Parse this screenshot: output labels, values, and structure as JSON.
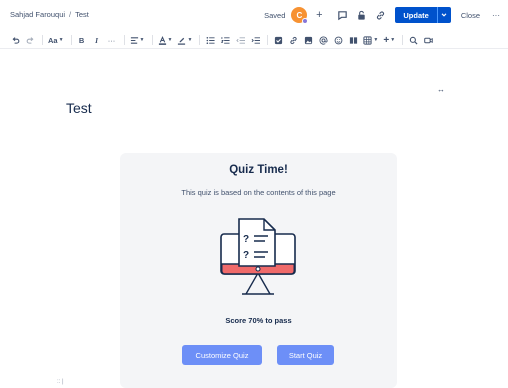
{
  "breadcrumb": {
    "space": "Sahjad Farouqui",
    "separator": "/",
    "page": "Test"
  },
  "header": {
    "saved_label": "Saved",
    "avatar_initial": "C",
    "add_label": "+",
    "update_label": "Update",
    "close_label": "Close",
    "more_label": "···"
  },
  "toolbar": {
    "text_style_label": "Aa",
    "bold_label": "B",
    "italic_label": "I",
    "more_formatting_label": "···",
    "insert_label": "+"
  },
  "page": {
    "title": "Test",
    "expand_label": "↔"
  },
  "quiz": {
    "title": "Quiz Time!",
    "description": "This quiz is based on the contents of this page",
    "score_text": "Score 70% to pass",
    "customize_label": "Customize Quiz",
    "start_label": "Start Quiz"
  },
  "footer": {
    "mark": ":: |"
  },
  "colors": {
    "primary": "#0052cc",
    "quiz_button": "#6d8ff7",
    "card_bg": "#f4f5f7",
    "monitor_red": "#f06a6a",
    "avatar": "#f79232"
  }
}
